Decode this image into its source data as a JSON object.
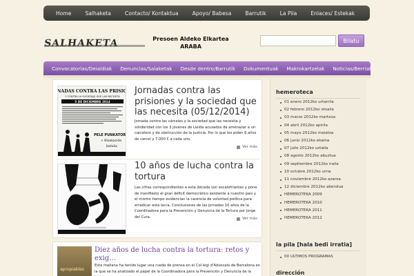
{
  "topnav": {
    "items": [
      "Home",
      "Salhaketa",
      "Contacto/ Kontaktua",
      "Apoyo/ Babesa",
      "Barrutik",
      "La Pila",
      "Enlaces/ Estekak"
    ]
  },
  "header": {
    "logo_text": "SALHAKETA",
    "tagline_line1": "Presoen Aldeko Elkartea",
    "tagline_line2": "ARABA",
    "search_placeholder": "",
    "search_button": "Bilatu"
  },
  "catbar": {
    "items": [
      "Convocatorias/Deialdiak",
      "Denuncias/Salaketak",
      "Desde dentro/Barrutik",
      "Dokumentuak",
      "Makrokartzelak",
      "Noticias/Berriak"
    ]
  },
  "posts": [
    {
      "title": "Jornadas contra las prisiones y la sociedad que las necesita (05/12/2014)",
      "excerpt": "Jornada contra las cárceles y la sociedad que las necesita y solidaridad con los 3 jóvenes de Lleida acusados de amenazar a un carcelero y de obstrucción de la justicia. Por lo que les piden 6 años de carcel y 7.000 € a cada uno.",
      "more": "Ver más",
      "thumb_title": "JORNADAS CONTRA LAS PRISIONES Y CONTRA LA SOCIEDAD QUE LAS NECESITA",
      "thumb_date": "5 DE DICIEMBRE 2014",
      "thumb_caption1": "PELE PUNKATOR",
      "thumb_caption2": "+ Kloakacide",
      "thumb_caption3": "batuka"
    },
    {
      "title": "10 años de lucha contra la tortura",
      "excerpt": "Las cifras correspondientes a esta década son escalofriantes y pone de manifiesto el gran déficit democrático existente a nuestro país y el mismo tiempo evidencian la carencia de voluntad política para erradicar esta lacra. Conclusiones de las jornadas 10 años de la Coordinadora para la Prevención y Denuncia de la Tortura por Jorge del Cura.",
      "more": "Ver más"
    },
    {
      "title": "Diez años de lucha contra la tortura: retos y exig…",
      "excerpt": "Esta mañana ha tenido lugar una rueda de prensa en el Col·legi d'Advocats de Barcelona en la que se ha analizado el papel de la Coordinadora para la Prevención y Denuncia de la tortura",
      "thumb_label": "apropiables"
    }
  ],
  "sidebar": {
    "hemeroteca_title": "hemeroteca",
    "hemeroteca": [
      "01 enero 2012ko urtarrila",
      "02 febrero 2012ko otsaila",
      "03 marzo 2012ko martxoa",
      "04 abril 2012ko apirila",
      "05 mayo 2012ko maiatza",
      "06 junio 2012ko ekaina",
      "07 julio 2012ko uztaila",
      "08 agosto 2012ko abuztua",
      "09 septiembre 2012ko iraila",
      "10 octubre 2012ko urria",
      "11 noviembre 2012ko azaroa",
      "12 diciembre 2012ko abendua",
      "HEMEROTEKA 2009",
      "HEMEROTEKA 2010",
      "HEMEROTEKA 2011",
      "HEMEROTEKA 2012"
    ],
    "lapila_title": "la pila [hala bedi irratia]",
    "lapila": [
      "00 ULTIMOS PROGRAMAS"
    ],
    "direccion_title": "dirección"
  },
  "colors": {
    "accent_purple": "#8c5cb5",
    "topnav_dark": "#45453e",
    "background": "#f6f1e2"
  }
}
